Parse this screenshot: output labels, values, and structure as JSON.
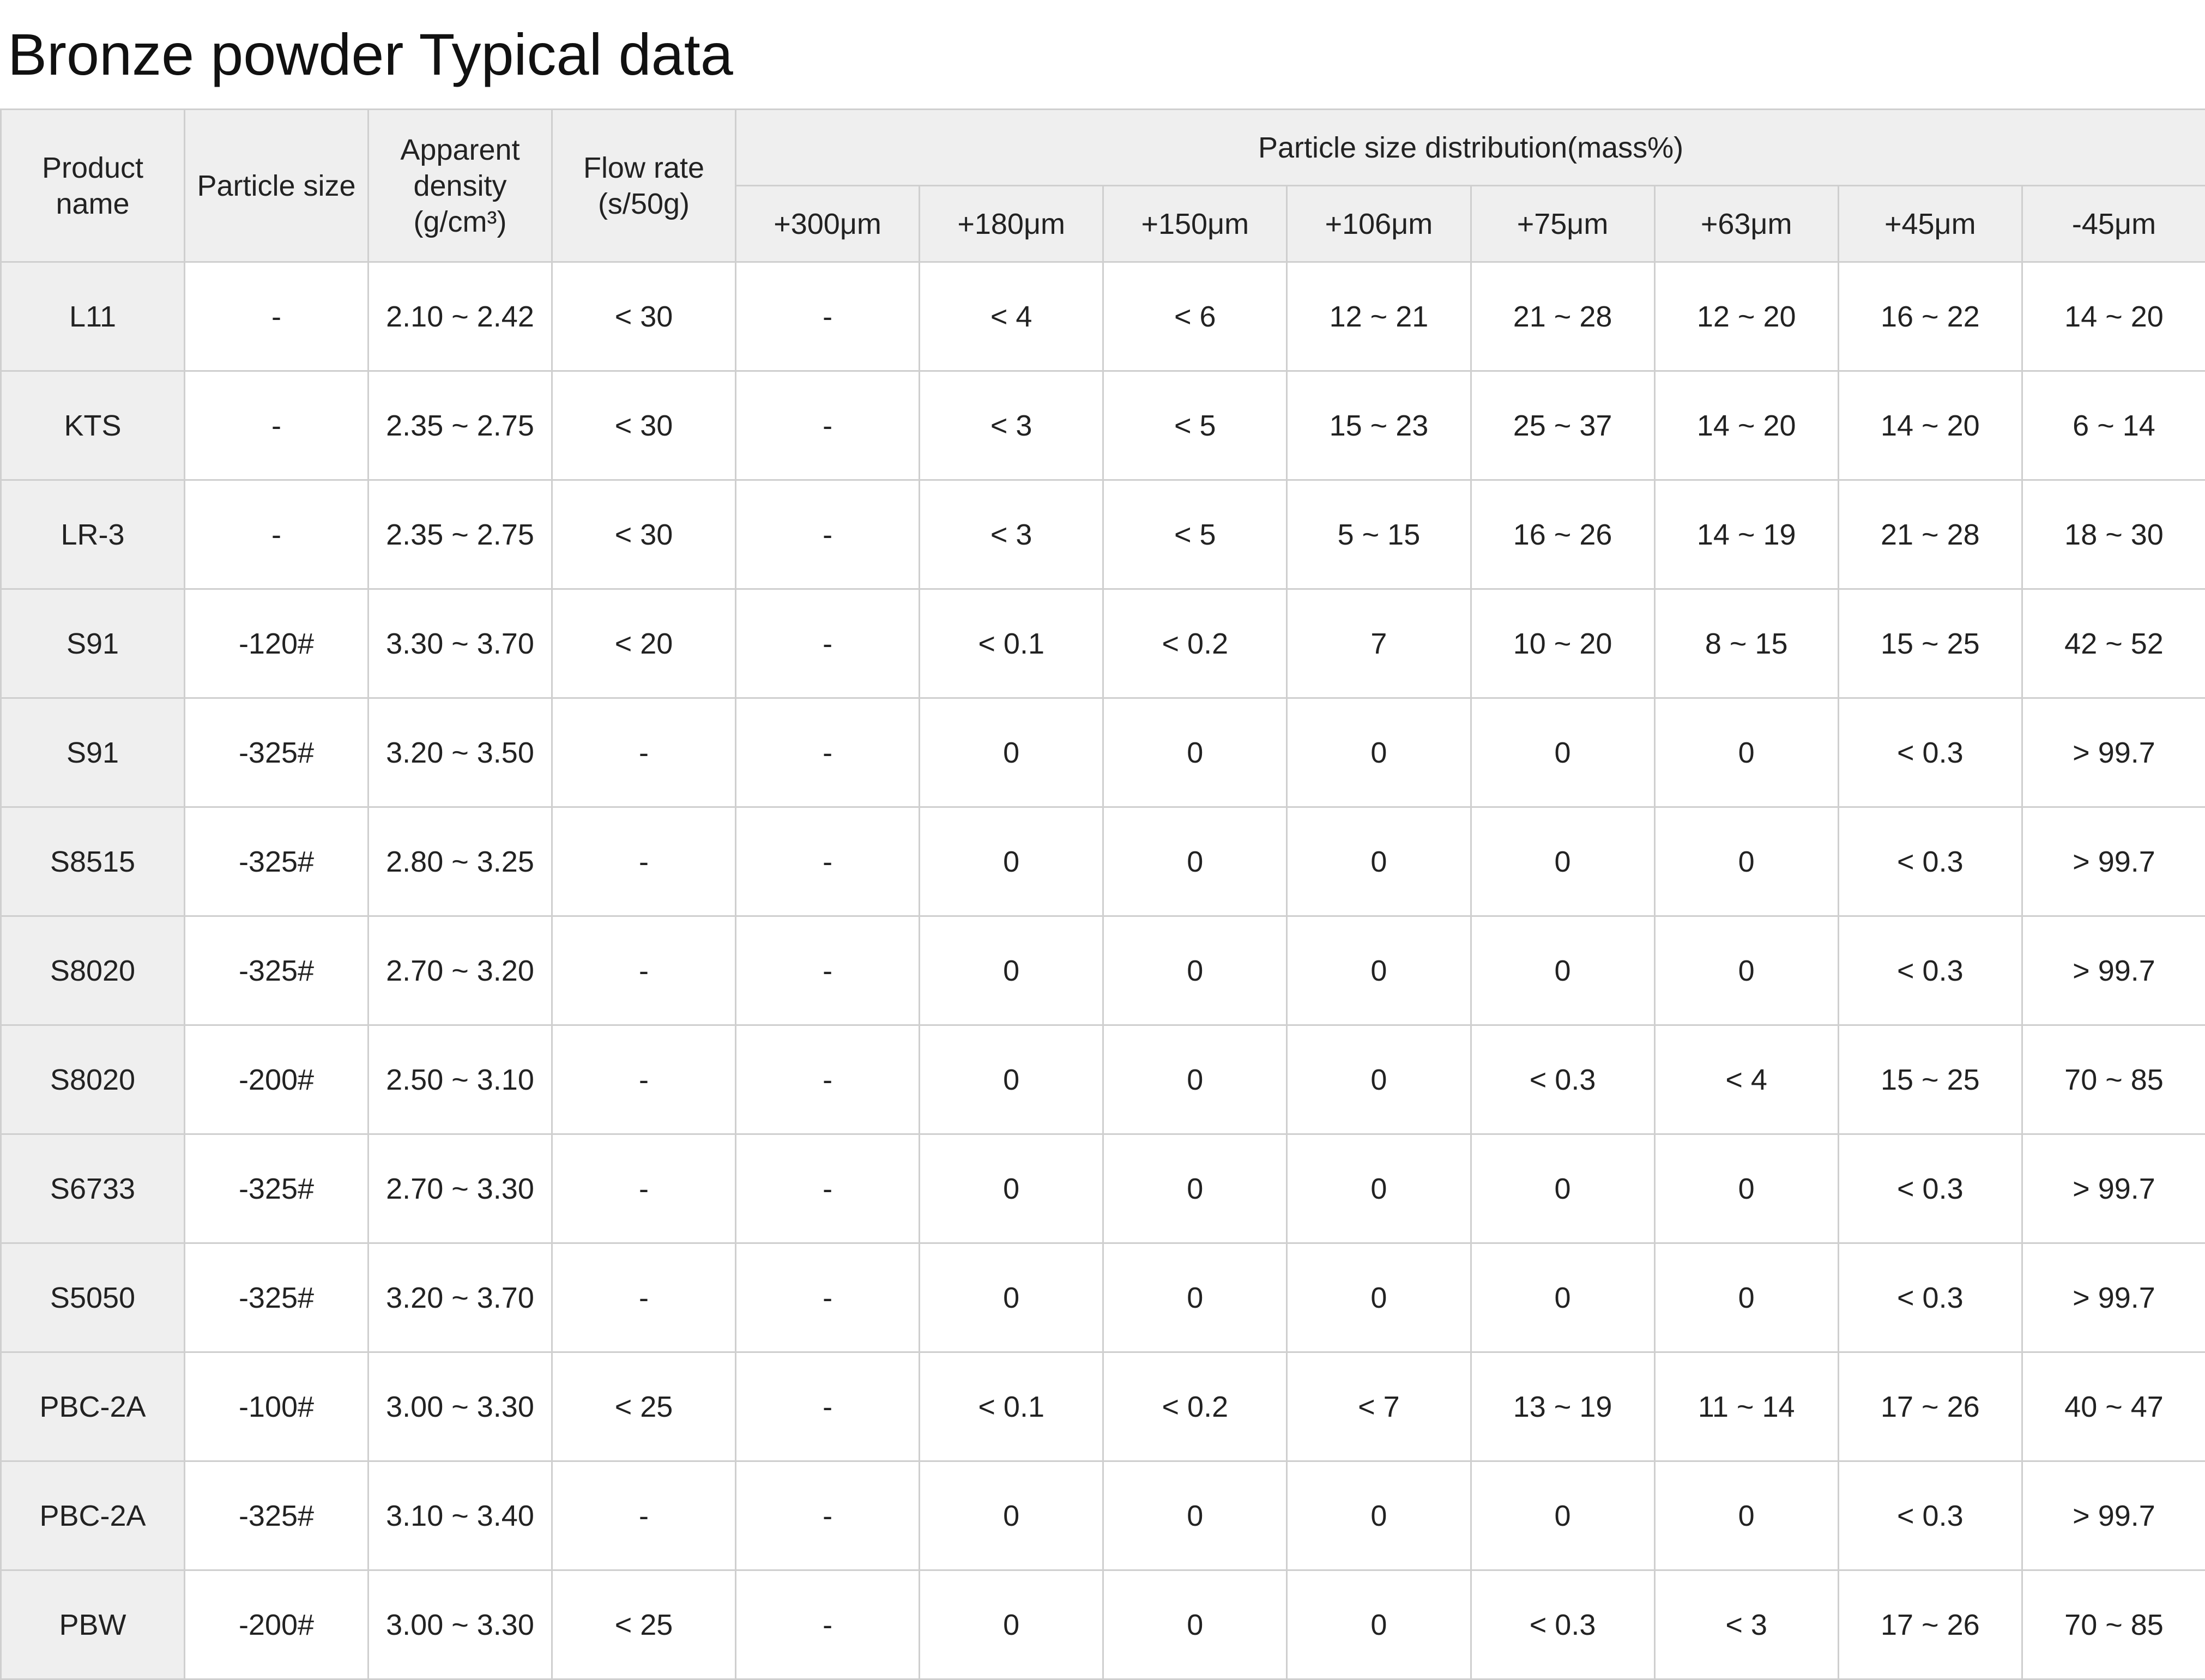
{
  "title": "Bronze powder Typical data",
  "headers": {
    "product_name": "Product name",
    "particle_size": "Particle size",
    "apparent_density": "Apparent density (g/cm³)",
    "flow_rate": "Flow rate (s/50g)",
    "distribution": "Particle size distribution(mass%)",
    "distribution_columns": [
      "+300μm",
      "+180μm",
      "+150μm",
      "+106μm",
      "+75μm",
      "+63μm",
      "+45μm",
      "-45μm"
    ]
  },
  "rows": [
    {
      "name": "L11",
      "particle_size": "-",
      "apparent_density": "2.10 ~ 2.42",
      "flow_rate": "< 30",
      "dist": [
        "-",
        "< 4",
        "< 6",
        "12 ~ 21",
        "21 ~ 28",
        "12 ~ 20",
        "16 ~ 22",
        "14 ~ 20"
      ]
    },
    {
      "name": "KTS",
      "particle_size": "-",
      "apparent_density": "2.35 ~ 2.75",
      "flow_rate": "< 30",
      "dist": [
        "-",
        "< 3",
        "< 5",
        "15 ~ 23",
        "25 ~ 37",
        "14 ~ 20",
        "14 ~ 20",
        "6 ~ 14"
      ]
    },
    {
      "name": "LR-3",
      "particle_size": "-",
      "apparent_density": "2.35 ~ 2.75",
      "flow_rate": "< 30",
      "dist": [
        "-",
        "< 3",
        "< 5",
        "5 ~ 15",
        "16 ~ 26",
        "14 ~ 19",
        "21 ~ 28",
        "18 ~ 30"
      ]
    },
    {
      "name": "S91",
      "particle_size": "-120#",
      "apparent_density": "3.30 ~ 3.70",
      "flow_rate": "< 20",
      "dist": [
        "-",
        "< 0.1",
        "< 0.2",
        "7",
        "10 ~ 20",
        "8 ~ 15",
        "15 ~ 25",
        "42 ~ 52"
      ]
    },
    {
      "name": "S91",
      "particle_size": "-325#",
      "apparent_density": "3.20 ~ 3.50",
      "flow_rate": "-",
      "dist": [
        "-",
        "0",
        "0",
        "0",
        "0",
        "0",
        "< 0.3",
        "> 99.7"
      ]
    },
    {
      "name": "S8515",
      "particle_size": "-325#",
      "apparent_density": "2.80 ~ 3.25",
      "flow_rate": "-",
      "dist": [
        "-",
        "0",
        "0",
        "0",
        "0",
        "0",
        "< 0.3",
        "> 99.7"
      ]
    },
    {
      "name": "S8020",
      "particle_size": "-325#",
      "apparent_density": "2.70 ~ 3.20",
      "flow_rate": "-",
      "dist": [
        "-",
        "0",
        "0",
        "0",
        "0",
        "0",
        "< 0.3",
        "> 99.7"
      ]
    },
    {
      "name": "S8020",
      "particle_size": "-200#",
      "apparent_density": "2.50 ~ 3.10",
      "flow_rate": "-",
      "dist": [
        "-",
        "0",
        "0",
        "0",
        "< 0.3",
        "< 4",
        "15 ~ 25",
        "70 ~ 85"
      ]
    },
    {
      "name": "S6733",
      "particle_size": "-325#",
      "apparent_density": "2.70 ~ 3.30",
      "flow_rate": "-",
      "dist": [
        "-",
        "0",
        "0",
        "0",
        "0",
        "0",
        "< 0.3",
        "> 99.7"
      ]
    },
    {
      "name": "S5050",
      "particle_size": "-325#",
      "apparent_density": "3.20 ~ 3.70",
      "flow_rate": "-",
      "dist": [
        "-",
        "0",
        "0",
        "0",
        "0",
        "0",
        "< 0.3",
        "> 99.7"
      ]
    },
    {
      "name": "PBC-2A",
      "particle_size": "-100#",
      "apparent_density": "3.00 ~ 3.30",
      "flow_rate": "< 25",
      "dist": [
        "-",
        "< 0.1",
        "< 0.2",
        "< 7",
        "13 ~ 19",
        "11 ~ 14",
        "17 ~ 26",
        "40 ~ 47"
      ]
    },
    {
      "name": "PBC-2A",
      "particle_size": "-325#",
      "apparent_density": "3.10 ~ 3.40",
      "flow_rate": "-",
      "dist": [
        "-",
        "0",
        "0",
        "0",
        "0",
        "0",
        "< 0.3",
        "> 99.7"
      ]
    },
    {
      "name": "PBW",
      "particle_size": "-200#",
      "apparent_density": "3.00 ~ 3.30",
      "flow_rate": "< 25",
      "dist": [
        "-",
        "0",
        "0",
        "0",
        "< 0.3",
        "< 3",
        "17 ~ 26",
        "70 ~ 85"
      ]
    }
  ]
}
